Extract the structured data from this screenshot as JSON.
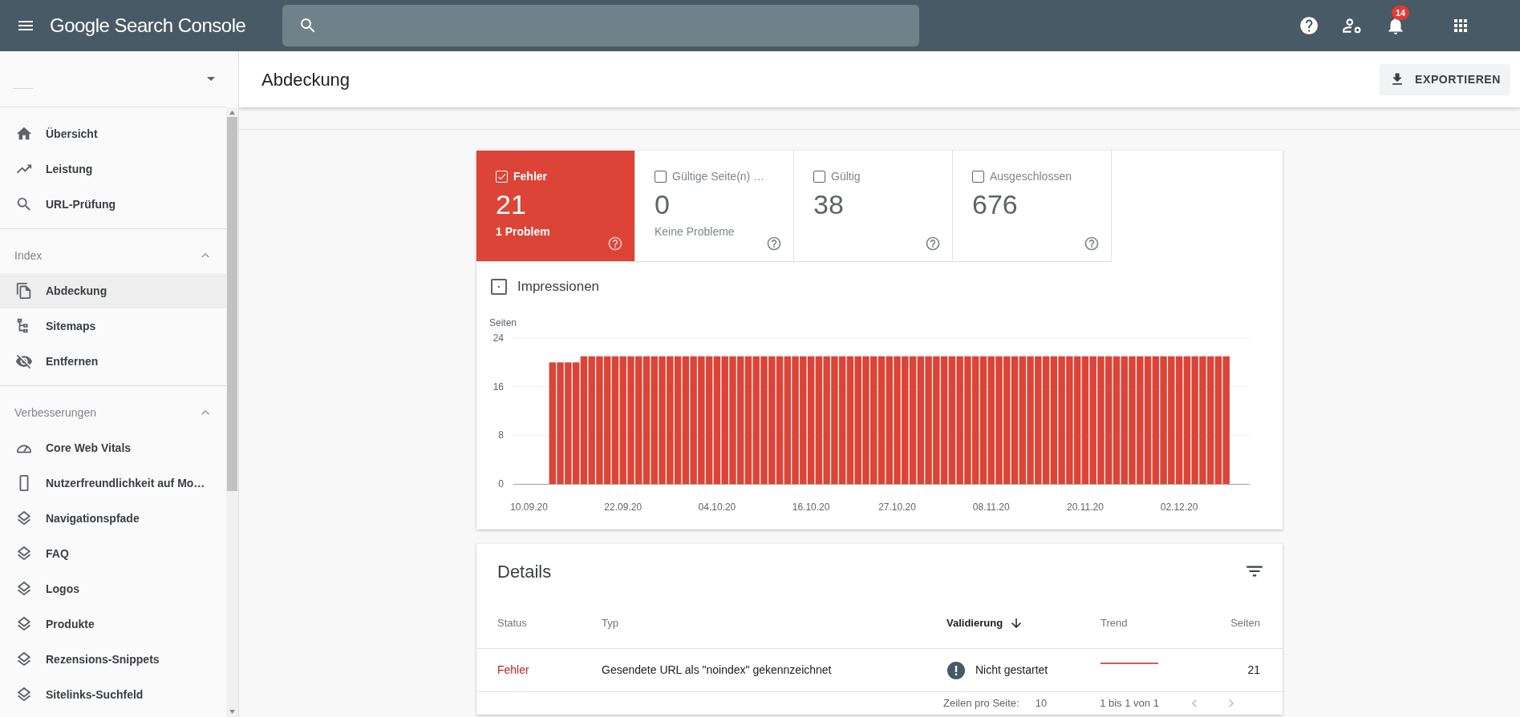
{
  "app": {
    "title": "Google Search Console"
  },
  "notifications": {
    "count": "14"
  },
  "sidebar": {
    "sections": [
      {
        "items": [
          {
            "label": "Übersicht",
            "selected": false
          },
          {
            "label": "Leistung",
            "selected": false
          },
          {
            "label": "URL-Prüfung",
            "selected": false
          }
        ]
      },
      {
        "title": "Index",
        "expanded": true,
        "items": [
          {
            "label": "Abdeckung",
            "selected": true
          },
          {
            "label": "Sitemaps",
            "selected": false
          },
          {
            "label": "Entfernen",
            "selected": false
          }
        ]
      },
      {
        "title": "Verbesserungen",
        "expanded": true,
        "items": [
          {
            "label": "Core Web Vitals",
            "selected": false
          },
          {
            "label": "Nutzerfreundlichkeit auf Mo…",
            "selected": false
          },
          {
            "label": "Navigationspfade",
            "selected": false
          },
          {
            "label": "FAQ",
            "selected": false
          },
          {
            "label": "Logos",
            "selected": false
          },
          {
            "label": "Produkte",
            "selected": false
          },
          {
            "label": "Rezensions-Snippets",
            "selected": false
          },
          {
            "label": "Sitelinks-Suchfeld",
            "selected": false
          }
        ]
      }
    ]
  },
  "page_header": {
    "title": "Abdeckung",
    "export_button": "EXPORTIEREN"
  },
  "summary_cards": [
    {
      "label": "Fehler",
      "value": "21",
      "subtitle": "1 Problem",
      "checked": true
    },
    {
      "label": "Gültige Seite(n) …",
      "value": "0",
      "subtitle": "Keine Probleme",
      "checked": false
    },
    {
      "label": "Gültig",
      "value": "38",
      "checked": false
    },
    {
      "label": "Ausgeschlossen",
      "value": "676",
      "checked": false
    }
  ],
  "impressions": {
    "label": "Impressionen",
    "checked": false
  },
  "chart_data": {
    "type": "bar",
    "ylabel": "Seiten",
    "categories": [
      "10.09.20",
      null,
      null,
      null,
      null,
      null,
      null,
      null,
      null,
      null,
      null,
      null,
      "22.09.20",
      null,
      null,
      null,
      null,
      null,
      null,
      null,
      null,
      null,
      null,
      null,
      "04.10.20",
      null,
      null,
      null,
      null,
      null,
      null,
      null,
      null,
      null,
      null,
      null,
      "16.10.20",
      null,
      null,
      null,
      null,
      null,
      null,
      null,
      null,
      null,
      null,
      "27.10.20",
      null,
      null,
      null,
      null,
      null,
      null,
      null,
      null,
      null,
      null,
      null,
      "08.11.20",
      null,
      null,
      null,
      null,
      null,
      null,
      null,
      null,
      null,
      null,
      null,
      "20.11.20",
      null,
      null,
      null,
      null,
      null,
      null,
      null,
      null,
      null,
      null,
      null,
      "02.12.20",
      null,
      null,
      null,
      null,
      null,
      null
    ],
    "series": [
      {
        "color": "#db4437",
        "values": [
          null,
          null,
          null,
          20,
          20,
          20,
          20,
          21,
          21,
          21,
          21,
          21,
          21,
          21,
          21,
          21,
          21,
          21,
          21,
          21,
          21,
          21,
          21,
          21,
          21,
          21,
          21,
          21,
          21,
          21,
          21,
          21,
          21,
          21,
          21,
          21,
          21,
          21,
          21,
          21,
          21,
          21,
          21,
          21,
          21,
          21,
          21,
          21,
          21,
          21,
          21,
          21,
          21,
          21,
          21,
          21,
          21,
          21,
          21,
          21,
          21,
          21,
          21,
          21,
          21,
          21,
          21,
          21,
          21,
          21,
          21,
          21,
          21,
          21,
          21,
          21,
          21,
          21,
          21,
          21,
          21,
          21,
          21,
          21,
          21,
          21,
          21,
          21,
          21,
          21
        ]
      }
    ],
    "ylim": [
      0,
      24
    ],
    "yticks": [
      0,
      8,
      16,
      24
    ]
  },
  "details": {
    "title": "Details",
    "columns": [
      {
        "label": "Status",
        "sorted": false
      },
      {
        "label": "Typ",
        "sorted": false
      },
      {
        "label": "Validierung",
        "sorted": true
      },
      {
        "label": "Trend",
        "sorted": false
      },
      {
        "label": "Seiten",
        "sorted": false
      }
    ],
    "rows": [
      {
        "kind": "error",
        "status": "Fehler",
        "type": "Gesendete URL als \"noindex\" gekennzeichnet",
        "validation": "Nicht gestartet",
        "pages": "21"
      }
    ],
    "pagination": {
      "rows_per_page_label": "Zeilen pro Seite:",
      "rows_per_page": "10",
      "range": "1 bis 1 von 1"
    }
  }
}
